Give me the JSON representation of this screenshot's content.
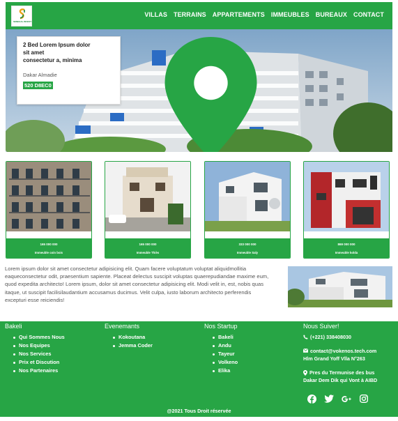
{
  "header": {
    "logo_text": "SENEGAL INVEST",
    "nav": [
      "VILLAS",
      "TERRAINS",
      "APPARTEMENTS",
      "IMMEUBLES",
      "BUREAUX",
      "CONTACT"
    ]
  },
  "hero": {
    "title_line1": "2 Bed Lorem Ipsum dolor",
    "title_line2": "sit amet",
    "title_line3": "consectetur a, minima",
    "location": "Dakar Almadie",
    "price": "520 D8EC0"
  },
  "listings": [
    {
      "price": "165 000 000",
      "label": "Immeuble coin bois"
    },
    {
      "price": "165 000 000",
      "label": "Immeuble Thiès"
    },
    {
      "price": "333 000 000",
      "label": "Immeuble Saly"
    },
    {
      "price": "869 000 000",
      "label": "Immeuble kolda"
    }
  ],
  "about": {
    "text": "Lorem ipsum dolor sit amet consectetur adipisicing elit. Quam facere voluptatum voluptat aliquidmollitia eaqueconsectetur odit, praesentium sapiente. Placeat delectus suscipit voluptas quaerepudiandae maxime eum, quod expedita architecto! Lorem ipsum, dolor sit amet consectetur adipisicing elit. Modi velit in, est, nobis quas itaque, ut suscipit facilisilaudantium accusamus ducimus. Velit culpa, iusto laborum architecto perferendis excepturi esse reiciendis!"
  },
  "footer": {
    "col1": {
      "title": "Bakeli",
      "items": [
        "Qui Sommes Nous",
        "Nos Equipes",
        "Nos Services",
        "Prix et Discution",
        "Nos Partenaires"
      ]
    },
    "col2": {
      "title": "Evenemants",
      "items": [
        "Kokoutana",
        "Jemma Coder"
      ]
    },
    "col3": {
      "title": "Nos Startup",
      "items": [
        "Bakeli",
        "Andu",
        "Tayeur",
        "Volkeno",
        "Elika"
      ]
    },
    "col4": {
      "title": "Nous Suiver!",
      "phone": "(+221) 338408030",
      "email": "contact@vokenos.tech.com",
      "address_line1": "Hlm Grand Yoff Vlla N°263",
      "address2_line1": "Pres du Termunise des bus",
      "address2_line2": "Dakar Dem Dik qui Vont à AIBD"
    },
    "social_icons": [
      "facebook-icon",
      "twitter-icon",
      "google-plus-icon",
      "instagram-icon"
    ],
    "copyright": "@2021 Tous Droit réservée"
  },
  "colors": {
    "brand": "#27a545",
    "price_bg": "#27a545"
  }
}
